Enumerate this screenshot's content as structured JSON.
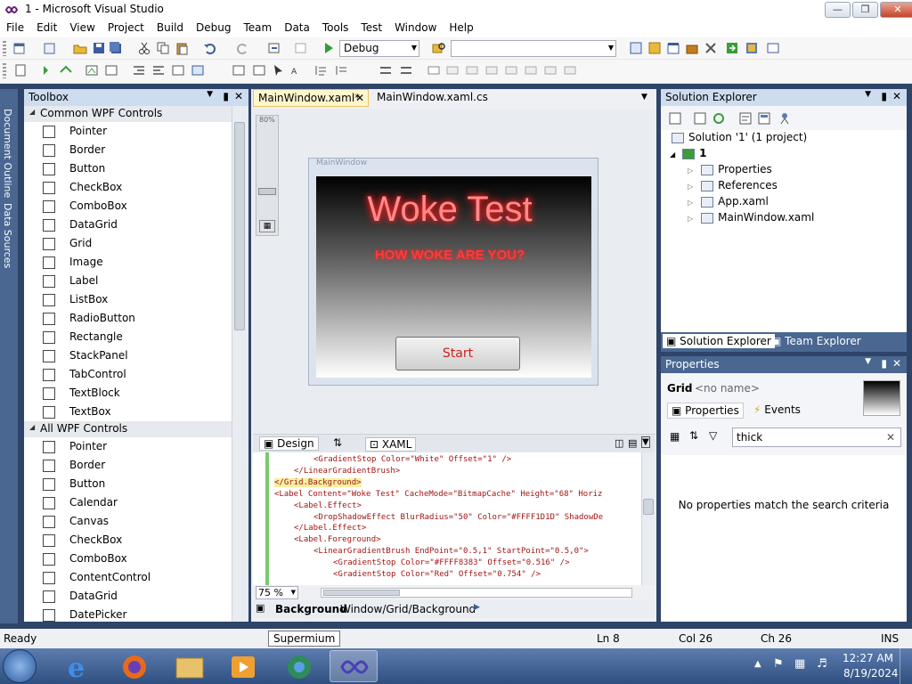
{
  "window": {
    "title": "1 - Microsoft Visual Studio"
  },
  "menu": [
    "File",
    "Edit",
    "View",
    "Project",
    "Build",
    "Debug",
    "Team",
    "Data",
    "Tools",
    "Test",
    "Window",
    "Help"
  ],
  "toolbar": {
    "config_value": "Debug",
    "target_value": ""
  },
  "left_strip": {
    "document_outline": "Document Outline",
    "data_sources": "Data Sources"
  },
  "toolbox": {
    "title": "Toolbox",
    "categories": [
      {
        "name": "Common WPF Controls",
        "items": [
          "Pointer",
          "Border",
          "Button",
          "CheckBox",
          "ComboBox",
          "DataGrid",
          "Grid",
          "Image",
          "Label",
          "ListBox",
          "RadioButton",
          "Rectangle",
          "StackPanel",
          "TabControl",
          "TextBlock",
          "TextBox"
        ]
      },
      {
        "name": "All WPF Controls",
        "items": [
          "Pointer",
          "Border",
          "Button",
          "Calendar",
          "Canvas",
          "CheckBox",
          "ComboBox",
          "ContentControl",
          "DataGrid",
          "DatePicker"
        ]
      }
    ]
  },
  "editor": {
    "tabs": [
      {
        "label": "MainWindow.xaml*"
      },
      {
        "label": "MainWindow.xaml.cs"
      }
    ],
    "zoom_slider_label": "80%",
    "wpf_window_title": "MainWindow",
    "app_title": "Woke Test",
    "app_subtitle": "HOW WOKE ARE YOU?",
    "start_button": "Start",
    "split_tabs": {
      "design": "Design",
      "xaml": "XAML"
    },
    "code_lines": [
      "<GradientStop Color=\"White\" Offset=\"1\" />",
      "</LinearGradientBrush>",
      "</Grid.Background>",
      "<Label Content=\"Woke Test\" CacheMode=\"BitmapCache\" Height=\"68\" Horiz",
      "<Label.Effect>",
      "<DropShadowEffect BlurRadius=\"50\" Color=\"#FFFF1D1D\" ShadowDe",
      "</Label.Effect>",
      "<Label.Foreground>",
      "<LinearGradientBrush EndPoint=\"0.5,1\" StartPoint=\"0.5,0\">",
      "<GradientStop Color=\"#FFFF8383\" Offset=\"0.516\" />",
      "<GradientStop Color=\"Red\" Offset=\"0.754\" />"
    ],
    "zoom": "75 %",
    "breadcrumb_bold": "Background",
    "breadcrumb_path": "Window/Grid/Background"
  },
  "solution_explorer": {
    "title": "Solution Explorer",
    "solution": "Solution '1' (1 project)",
    "project": "1",
    "items": [
      "Properties",
      "References",
      "App.xaml",
      "MainWindow.xaml"
    ],
    "tabs": [
      "Solution Explorer",
      "Team Explorer"
    ]
  },
  "properties": {
    "title": "Properties",
    "object_type": "Grid",
    "object_name": "<no name>",
    "tabs": [
      "Properties",
      "Events"
    ],
    "search_value": "thick",
    "empty_message": "No properties match the search criteria"
  },
  "status": {
    "ready": "Ready",
    "ln": "Ln 8",
    "col": "Col 26",
    "ch": "Ch 26",
    "ins": "INS"
  },
  "tooltip": "Supermium",
  "clock": {
    "time": "12:27 AM",
    "date": "8/19/2024"
  }
}
